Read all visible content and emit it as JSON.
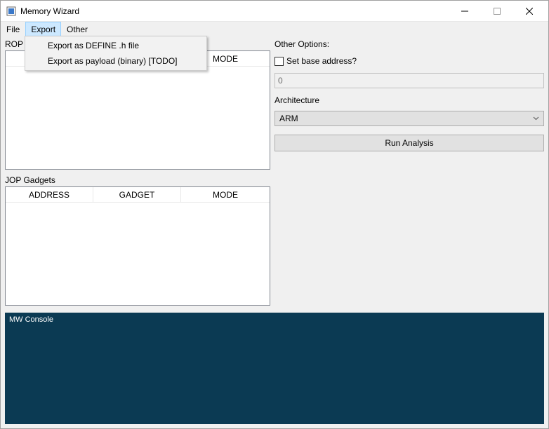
{
  "window": {
    "title": "Memory Wizard"
  },
  "menu": {
    "items": [
      "File",
      "Export",
      "Other"
    ],
    "active_index": 1,
    "dropdown": {
      "items": [
        "Export as DEFINE .h file",
        "Export as payload (binary) [TODO]"
      ]
    }
  },
  "left": {
    "rop_label": "ROP Gadgets",
    "jop_label": "JOP Gadgets",
    "columns": {
      "address": "ADDRESS",
      "gadget": "GADGET",
      "mode": "MODE"
    }
  },
  "right": {
    "other_options_label": "Other Options:",
    "set_base_label": "Set base address?",
    "base_value": "0",
    "architecture_label": "Architecture",
    "architecture_value": "ARM",
    "run_label": "Run Analysis"
  },
  "console": {
    "label": "MW Console"
  },
  "colors": {
    "console_bg": "#0b3a53"
  }
}
